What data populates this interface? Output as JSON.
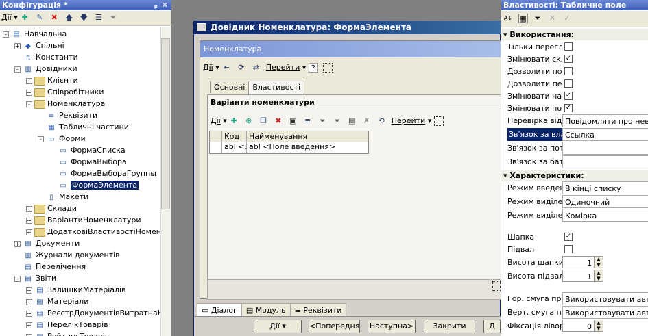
{
  "config_panel": {
    "title": "Конфігурація *",
    "pin": "ₚ",
    "close": "✕",
    "actions_label": "Дії",
    "tree": [
      {
        "label": "Навчальна",
        "indent": 0,
        "pm": "-",
        "icon": "config"
      },
      {
        "label": "Спільні",
        "indent": 1,
        "pm": "+",
        "icon": "common"
      },
      {
        "label": "Константи",
        "indent": 1,
        "pm": "",
        "icon": "const"
      },
      {
        "label": "Довідники",
        "indent": 1,
        "pm": "-",
        "icon": "catalog"
      },
      {
        "label": "Клієнти",
        "indent": 2,
        "pm": "+",
        "icon": "folder"
      },
      {
        "label": "Співробітники",
        "indent": 2,
        "pm": "+",
        "icon": "folder"
      },
      {
        "label": "Номенклатура",
        "indent": 2,
        "pm": "-",
        "icon": "folder"
      },
      {
        "label": "Реквізити",
        "indent": 3,
        "pm": "",
        "icon": "attr"
      },
      {
        "label": "Табличні частини",
        "indent": 3,
        "pm": "",
        "icon": "table"
      },
      {
        "label": "Форми",
        "indent": 3,
        "pm": "-",
        "icon": "forms"
      },
      {
        "label": "ФормаСписка",
        "indent": 4,
        "pm": "",
        "icon": "form"
      },
      {
        "label": "ФормаВыбора",
        "indent": 4,
        "pm": "",
        "icon": "form"
      },
      {
        "label": "ФормаВыбораГруппы",
        "indent": 4,
        "pm": "",
        "icon": "form"
      },
      {
        "label": "ФормаЭлемента",
        "indent": 4,
        "pm": "",
        "icon": "form",
        "selected": true
      },
      {
        "label": "Макети",
        "indent": 3,
        "pm": "",
        "icon": "layout"
      },
      {
        "label": "Склади",
        "indent": 2,
        "pm": "+",
        "icon": "folder"
      },
      {
        "label": "ВаріантиНоменклатури",
        "indent": 2,
        "pm": "+",
        "icon": "folder"
      },
      {
        "label": "ДодатковіВластивостіНоменклату",
        "indent": 2,
        "pm": "+",
        "icon": "folder"
      },
      {
        "label": "Документи",
        "indent": 1,
        "pm": "+",
        "icon": "docs"
      },
      {
        "label": "Журнали документів",
        "indent": 1,
        "pm": "",
        "icon": "journal"
      },
      {
        "label": "Перелічення",
        "indent": 1,
        "pm": "",
        "icon": "enum"
      },
      {
        "label": "Звіти",
        "indent": 1,
        "pm": "-",
        "icon": "reports"
      },
      {
        "label": "ЗалишкиМатеріалів",
        "indent": 2,
        "pm": "+",
        "icon": "report"
      },
      {
        "label": "Матеріали",
        "indent": 2,
        "pm": "+",
        "icon": "report"
      },
      {
        "label": "РеєстрДокументівВитратнаНакла",
        "indent": 2,
        "pm": "+",
        "icon": "report"
      },
      {
        "label": "ПерелікТоварів",
        "indent": 2,
        "pm": "+",
        "icon": "report"
      },
      {
        "label": "РейтингТоварів",
        "indent": 2,
        "pm": "+",
        "icon": "report"
      }
    ]
  },
  "window": {
    "title": "Довідник Номенклатура: ФормаЭлемента",
    "form_header": "Номенклатура",
    "toolbar": {
      "actions": "Дії",
      "goto": "Перейти",
      "help": "?"
    },
    "tabs": [
      {
        "label": "Основні"
      },
      {
        "label": "Властивості"
      }
    ],
    "section_title": "Варіанти номенклатури",
    "inner_toolbar": {
      "actions": "Дії",
      "goto": "Перейти"
    },
    "grid": {
      "columns": [
        "Код",
        "Найменування"
      ],
      "row": [
        "abl <...",
        "abl <Поле введення>"
      ]
    },
    "bottom_tabs": [
      "Діалог",
      "Модуль",
      "Реквізити"
    ],
    "buttons": {
      "actions": "Дії",
      "prev": "<Попередня",
      "next": "Наступна>",
      "close": "Закрити",
      "more": "Д"
    }
  },
  "props_panel": {
    "title": "Властивості: Табличне поле",
    "categories": {
      "usage": "Використання:",
      "features": "Характеристики:"
    },
    "usage": [
      {
        "label": "Тільки перегля",
        "checked": false
      },
      {
        "label": "Змінювати скл",
        "checked": true
      },
      {
        "label": "Дозволити поч",
        "checked": false
      },
      {
        "label": "Дозволити пер",
        "checked": false
      },
      {
        "label": "Змінювати нас",
        "checked": true
      },
      {
        "label": "Змінювати пози",
        "checked": true
      }
    ],
    "check_label": "Перевірка відом",
    "check_value": "Повідомляти про невідп",
    "link_owner_label": "Зв'язок за вла",
    "link_owner_value": "Ссылка",
    "link_stream_label": "Зв'язок за пото",
    "link_parent_label": "Зв'язок за бать",
    "features": [
      {
        "label": "Режим введен",
        "value": "В кінці списку"
      },
      {
        "label": "Режим виділен",
        "value": "Одиночний"
      },
      {
        "label": "Режим виділен",
        "value": "Комірка"
      }
    ],
    "header_label": "Шапка",
    "header_checked": true,
    "footer_label": "Підвал",
    "footer_checked": false,
    "header_height_label": "Висота шапки",
    "header_height": "1",
    "footer_height_label": "Висота підвалу",
    "footer_height": "1",
    "hscroll_label": "Гор. смуга про",
    "hscroll_value": "Використовувати автом",
    "vscroll_label": "Верт. смуга про",
    "vscroll_value": "Використовувати автом",
    "fix_left_label": "Фіксація ліворуч",
    "fix_left_value": "0"
  }
}
